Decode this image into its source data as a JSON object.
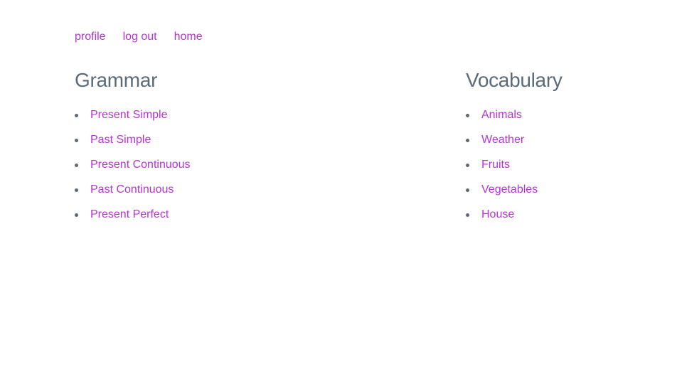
{
  "nav": {
    "profile": "profile",
    "logout": "log out",
    "home": "home"
  },
  "grammar": {
    "title": "Grammar",
    "items": [
      "Present Simple",
      "Past Simple",
      "Present Continuous",
      "Past Continuous",
      "Present Perfect"
    ]
  },
  "vocabulary": {
    "title": "Vocabulary",
    "items": [
      "Animals",
      "Weather",
      "Fruits",
      "Vegetables",
      "House"
    ]
  },
  "colors": {
    "link": "#b833d6",
    "heading": "#5d6b78",
    "bullet": "#5f6870"
  }
}
